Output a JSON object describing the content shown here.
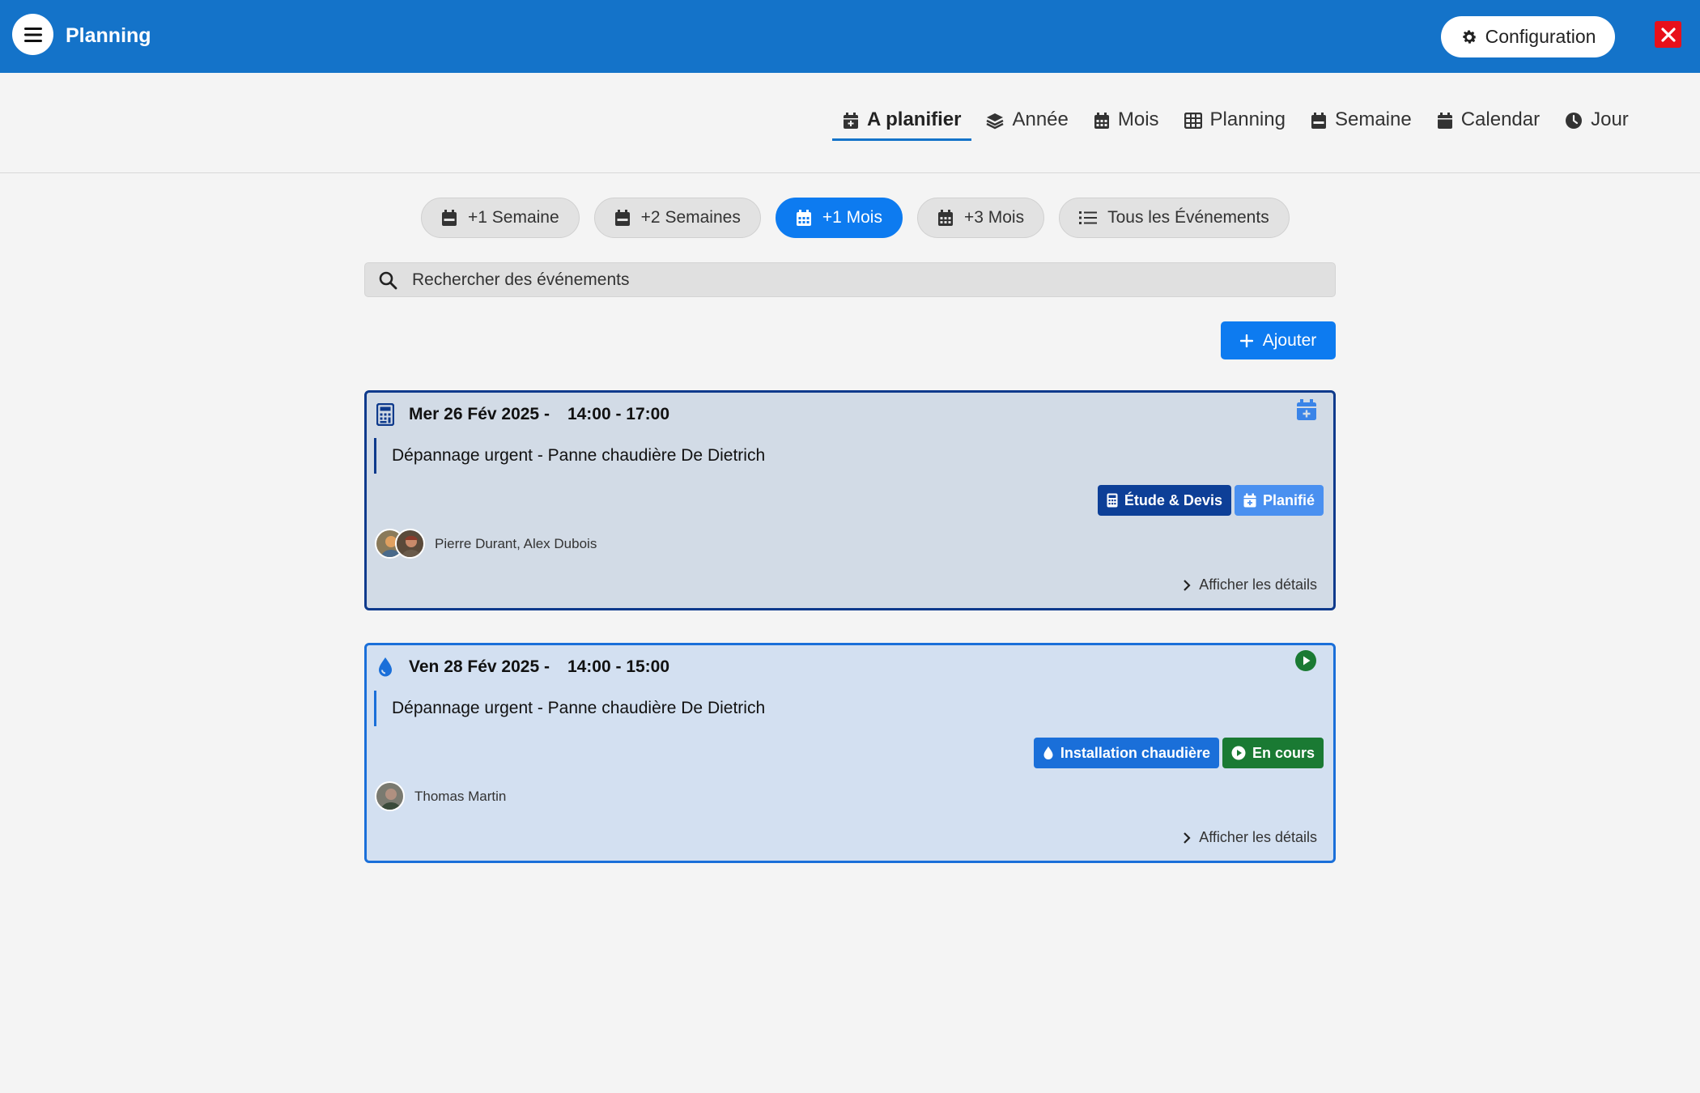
{
  "header": {
    "title": "Planning",
    "config_label": "Configuration"
  },
  "view_tabs": [
    {
      "label": "A planifier",
      "icon": "calendar-plus-icon",
      "active": true
    },
    {
      "label": "Année",
      "icon": "layers-icon"
    },
    {
      "label": "Mois",
      "icon": "calendar-grid-icon"
    },
    {
      "label": "Planning",
      "icon": "table-icon"
    },
    {
      "label": "Semaine",
      "icon": "calendar-week-icon"
    },
    {
      "label": "Calendar",
      "icon": "calendar-icon"
    },
    {
      "label": "Jour",
      "icon": "clock-icon"
    }
  ],
  "ranges": [
    {
      "label": "+1 Semaine",
      "icon": "calendar-week-icon"
    },
    {
      "label": "+2 Semaines",
      "icon": "calendar-week-icon"
    },
    {
      "label": "+1 Mois",
      "icon": "calendar-grid-icon",
      "active": true
    },
    {
      "label": "+3 Mois",
      "icon": "calendar-grid-icon"
    },
    {
      "label": "Tous les Événements",
      "icon": "list-icon"
    }
  ],
  "search": {
    "placeholder": "Rechercher des événements"
  },
  "add_label": "Ajouter",
  "events": [
    {
      "type_icon": "calculator-icon",
      "date": "Mer 26 Fév 2025 -",
      "time": "14:00 - 17:00",
      "title": "Dépannage urgent - Panne chaudière De Dietrich",
      "status_icon": "calendar-plus-icon",
      "badges": [
        {
          "label": "Étude & Devis",
          "icon": "calculator-icon",
          "color": "#0d3f97"
        },
        {
          "label": "Planifié",
          "icon": "calendar-plus-icon",
          "color": "#4a90f0"
        }
      ],
      "people": "Pierre Durant, Alex Dubois",
      "details": "Afficher les détails"
    },
    {
      "type_icon": "droplet-icon",
      "date": "Ven 28 Fév 2025 -",
      "time": "14:00 - 15:00",
      "title": "Dépannage urgent - Panne chaudière De Dietrich",
      "status_icon": "play-circle-icon",
      "badges": [
        {
          "label": "Installation chaudière",
          "icon": "droplet-icon",
          "color": "#1a6fd9"
        },
        {
          "label": "En cours",
          "icon": "play-circle-icon",
          "color": "#1a7a33"
        }
      ],
      "people": "Thomas Martin",
      "details": "Afficher les détails"
    }
  ],
  "colors": {
    "topbar": "#1473c9",
    "accent": "#0d7bf0",
    "close": "#e8101a"
  }
}
